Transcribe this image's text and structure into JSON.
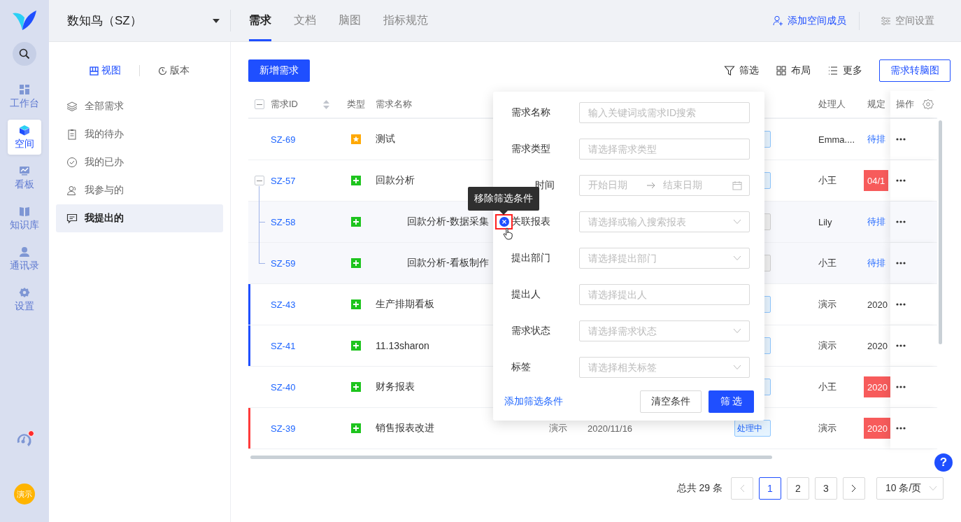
{
  "rail": {
    "items": [
      {
        "label": "工作台",
        "selected": false
      },
      {
        "label": "空间",
        "selected": true
      },
      {
        "label": "看板",
        "selected": false
      },
      {
        "label": "知识库",
        "selected": false
      },
      {
        "label": "通讯录",
        "selected": false
      },
      {
        "label": "设置",
        "selected": false
      }
    ],
    "notification_unread": true,
    "avatar": "演示"
  },
  "header": {
    "project": "数知鸟（SZ）",
    "tabs": [
      {
        "label": "需求",
        "selected": true
      },
      {
        "label": "文档",
        "selected": false
      },
      {
        "label": "脑图",
        "selected": false
      },
      {
        "label": "指标规范",
        "selected": false
      }
    ],
    "add_member": "添加空间成员",
    "settings": "空间设置"
  },
  "sidebar": {
    "modes": [
      {
        "label": "视图",
        "selected": true
      },
      {
        "label": "版本",
        "selected": false
      }
    ],
    "items": [
      {
        "label": "全部需求",
        "selected": false
      },
      {
        "label": "我的待办",
        "selected": false
      },
      {
        "label": "我的已办",
        "selected": false
      },
      {
        "label": "我参与的",
        "selected": false
      },
      {
        "label": "我提出的",
        "selected": true
      }
    ]
  },
  "toolbar": {
    "new_button": "新增需求",
    "actions": [
      "筛选",
      "布局",
      "更多"
    ],
    "mindmap_button": "需求转脑图"
  },
  "table": {
    "select_all_indeterminate": true,
    "columns": {
      "id": "需求ID",
      "type": "类型",
      "name": "需求名称",
      "handler": "处理人",
      "deadline": "规定",
      "actions": "操作"
    },
    "rows": [
      {
        "id": "SZ-69",
        "type": {
          "kind": "star"
        },
        "name": "测试",
        "status": {
          "kind": "processing"
        },
        "handler": "Emma....",
        "deadline": {
          "text": "待排",
          "kind": "link"
        }
      },
      {
        "id": "SZ-57",
        "type": {
          "kind": "plus"
        },
        "name": "回款分析",
        "status": {
          "kind": "processing"
        },
        "handler": "小王",
        "deadline": {
          "text": "04/1",
          "kind": "overdue"
        },
        "expanded": true,
        "children": [
          {
            "id": "SZ-58",
            "type": {
              "kind": "plus"
            },
            "name": "回款分析-数据采集",
            "status": {
              "kind": "pending"
            },
            "handler": "Lily",
            "deadline": {
              "text": "待排",
              "kind": "link"
            }
          },
          {
            "id": "SZ-59",
            "type": {
              "kind": "plus"
            },
            "name": "回款分析-看板制作",
            "status": {
              "kind": "pending"
            },
            "handler": "小王",
            "deadline": {
              "text": "待排",
              "kind": "link"
            }
          }
        ]
      },
      {
        "id": "SZ-43",
        "type": {
          "kind": "plus"
        },
        "name": "生产排期看板",
        "status": {
          "kind": "processing"
        },
        "handler": "演示",
        "deadline": {
          "text": "2020",
          "kind": "plain"
        },
        "color": "#1f4fff"
      },
      {
        "id": "SZ-41",
        "type": {
          "kind": "plus"
        },
        "name": "11.13sharon",
        "status": {
          "kind": "processing"
        },
        "handler": "演示",
        "deadline": {
          "text": "2020",
          "kind": "plain"
        },
        "color": "#1f4fff"
      },
      {
        "id": "SZ-40",
        "type": {
          "kind": "plus"
        },
        "name": "财务报表",
        "status": {
          "kind": "processing"
        },
        "handler": "小王",
        "deadline": {
          "text": "2020",
          "kind": "overdue"
        }
      },
      {
        "id": "SZ-39",
        "type": {
          "kind": "plus"
        },
        "name": "销售报表改进",
        "proposer": "演示",
        "date": "2020/11/16",
        "status": {
          "kind": "processing",
          "text": "处理中"
        },
        "handler": "演示",
        "deadline": {
          "text": "2020",
          "kind": "overdue"
        },
        "color": "#ff3b3b"
      }
    ]
  },
  "filter": {
    "fields": [
      {
        "label": "需求名称",
        "kind": "text",
        "placeholder": "输入关键词或需求ID搜索",
        "hovered": false
      },
      {
        "label": "需求类型",
        "kind": "text",
        "placeholder": "请选择需求类型",
        "hovered": false
      },
      {
        "label": "时间",
        "kind": "daterange",
        "start_placeholder": "开始日期",
        "end_placeholder": "结束日期",
        "hovered": false
      },
      {
        "label": "关联报表",
        "kind": "select",
        "placeholder": "请选择或输入搜索报表",
        "hovered": true
      },
      {
        "label": "提出部门",
        "kind": "select",
        "placeholder": "请选择提出部门",
        "hovered": false
      },
      {
        "label": "提出人",
        "kind": "text",
        "placeholder": "请选择提出人",
        "hovered": false
      },
      {
        "label": "需求状态",
        "kind": "select",
        "placeholder": "请选择需求状态",
        "hovered": false
      },
      {
        "label": "标签",
        "kind": "select",
        "placeholder": "请选择相关标签",
        "hovered": false
      }
    ],
    "tooltip": "移除筛选条件",
    "add_condition": "添加筛选条件",
    "clear_button": "清空条件",
    "submit_button": "筛 选"
  },
  "pagination": {
    "total": "总共 29 条",
    "prev_disabled": true,
    "next_disabled": false,
    "pages": [
      {
        "label": "1",
        "selected": true
      },
      {
        "label": "2",
        "selected": false
      },
      {
        "label": "3",
        "selected": false
      }
    ],
    "page_size": "10 条/页"
  },
  "help": "?"
}
